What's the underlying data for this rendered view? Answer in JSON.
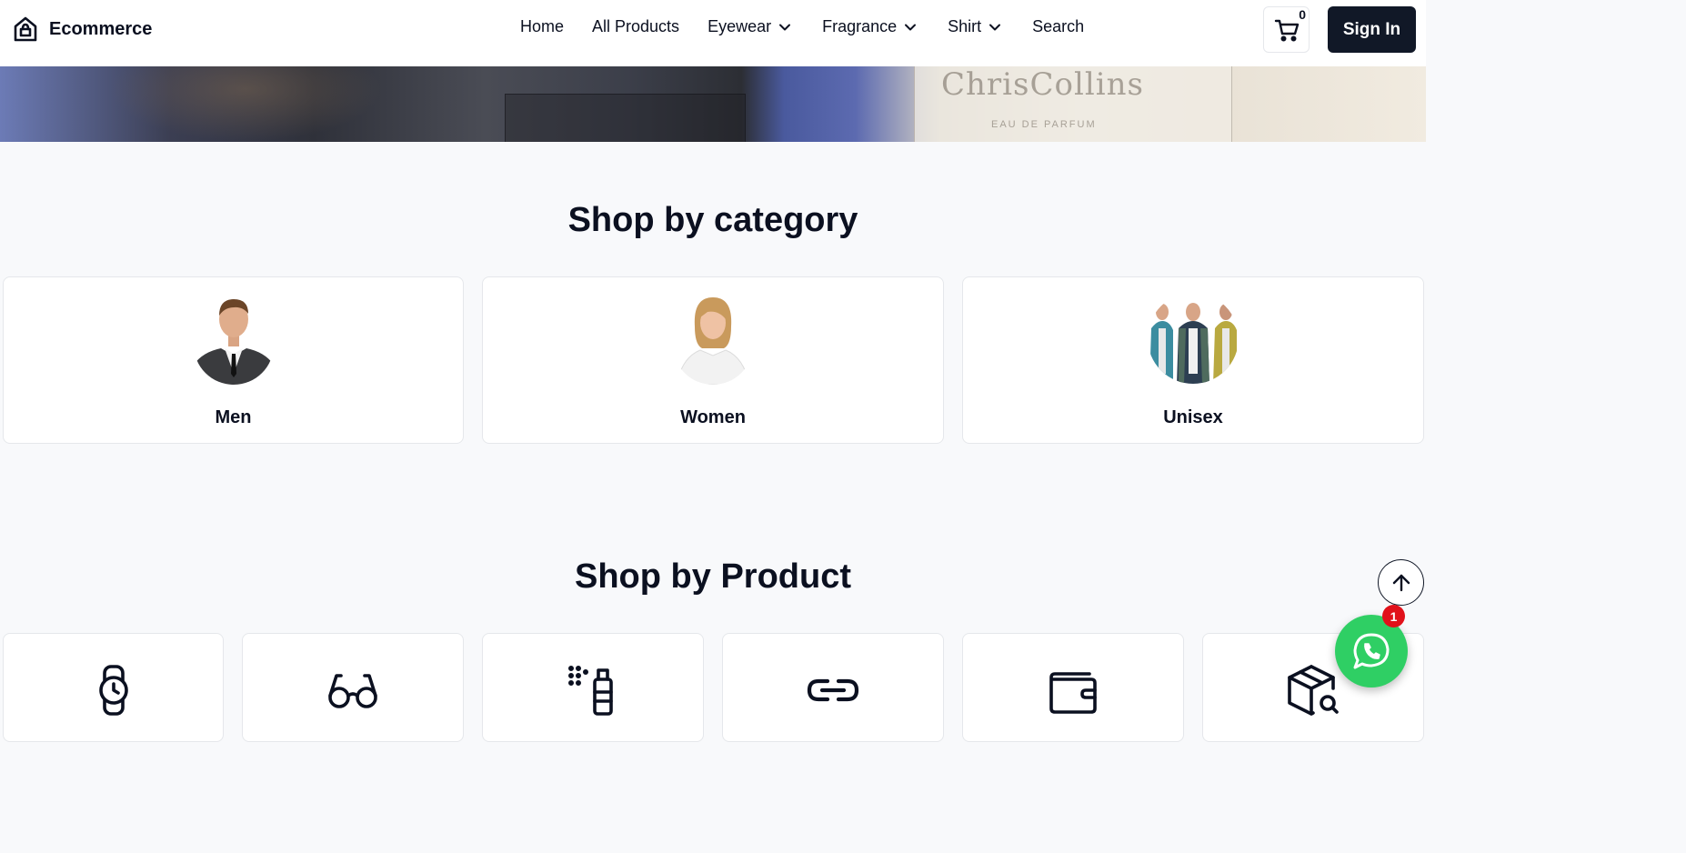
{
  "header": {
    "brand": "Ecommerce",
    "nav": [
      {
        "label": "Home",
        "dropdown": false
      },
      {
        "label": "All Products",
        "dropdown": false
      },
      {
        "label": "Eyewear",
        "dropdown": true
      },
      {
        "label": "Fragrance",
        "dropdown": true
      },
      {
        "label": "Shirt",
        "dropdown": true
      },
      {
        "label": "Search",
        "dropdown": false
      }
    ],
    "cart_count": "0",
    "sign_in_label": "Sign In"
  },
  "banner": {
    "brand_text": "ChrisCollins",
    "sub_text": "EAU DE PARFUM"
  },
  "category_section": {
    "title": "Shop by category",
    "items": [
      {
        "label": "Men",
        "icon": "men-avatar"
      },
      {
        "label": "Women",
        "icon": "women-avatar"
      },
      {
        "label": "Unisex",
        "icon": "unisex-avatar"
      }
    ]
  },
  "product_section": {
    "title": "Shop by Product",
    "items": [
      {
        "icon": "watch-icon"
      },
      {
        "icon": "glasses-icon"
      },
      {
        "icon": "spray-bottle-icon"
      },
      {
        "icon": "link-icon"
      },
      {
        "icon": "wallet-icon"
      },
      {
        "icon": "package-search-icon"
      }
    ]
  },
  "floating": {
    "scroll_top_icon": "arrow-up-icon",
    "whatsapp_icon": "whatsapp-icon",
    "whatsapp_badge": "1"
  },
  "colors": {
    "primary_dark": "#111827",
    "page_bg": "#f8f9fb",
    "whatsapp_green": "#2fcf64",
    "badge_red": "#e1111a"
  }
}
